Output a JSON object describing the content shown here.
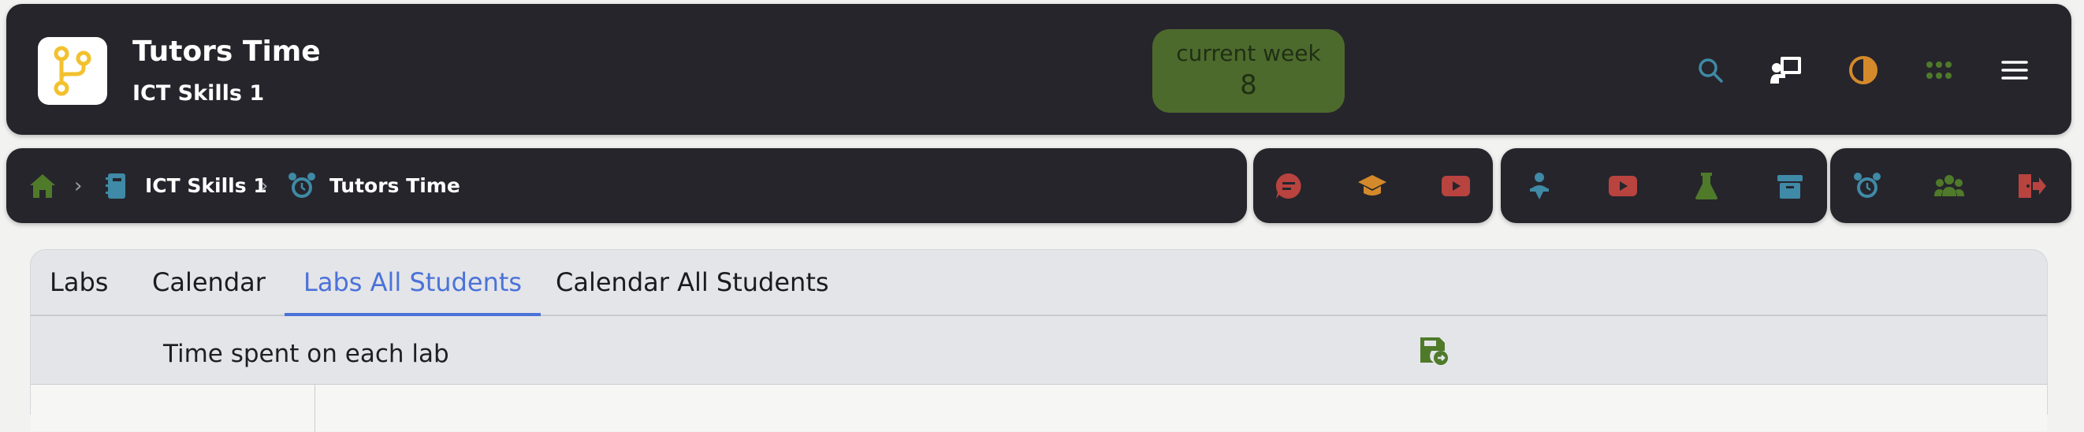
{
  "header": {
    "title": "Tutors Time",
    "subtitle": "ICT Skills 1",
    "week": {
      "label": "current week",
      "value": "8"
    },
    "icons": [
      "search-icon",
      "presentation-icon",
      "contrast-icon",
      "apps-grid-icon",
      "menu-icon"
    ]
  },
  "breadcrumb": {
    "home_icon": "home-icon",
    "items": [
      {
        "label": "ICT Skills 1",
        "icon": "notebook-icon"
      },
      {
        "label": "Tutors Time",
        "icon": "alarm-clock-icon"
      }
    ]
  },
  "toolbars": {
    "group_a": [
      "chat-icon",
      "graduation-cap-icon",
      "youtube-icon"
    ],
    "group_b": [
      "teacher-icon",
      "video-icon",
      "flask-icon",
      "archive-icon"
    ],
    "group_c": [
      "alarm-clock-icon",
      "people-icon",
      "logout-icon"
    ]
  },
  "tabs": [
    {
      "label": "Labs",
      "active": false
    },
    {
      "label": "Calendar",
      "active": false
    },
    {
      "label": "Labs All Students",
      "active": true
    },
    {
      "label": "Calendar All Students",
      "active": false
    }
  ],
  "section": {
    "title": "Time spent on each lab",
    "export_icon": "save-export-icon"
  },
  "colors": {
    "bar_bg": "#26252c",
    "week_badge": "#4d6a2d",
    "accent_blue": "#4a72d8",
    "orange": "#d48a2a",
    "red": "#b8433f",
    "teal": "#3f8aa6",
    "green": "#4f7a2a"
  }
}
